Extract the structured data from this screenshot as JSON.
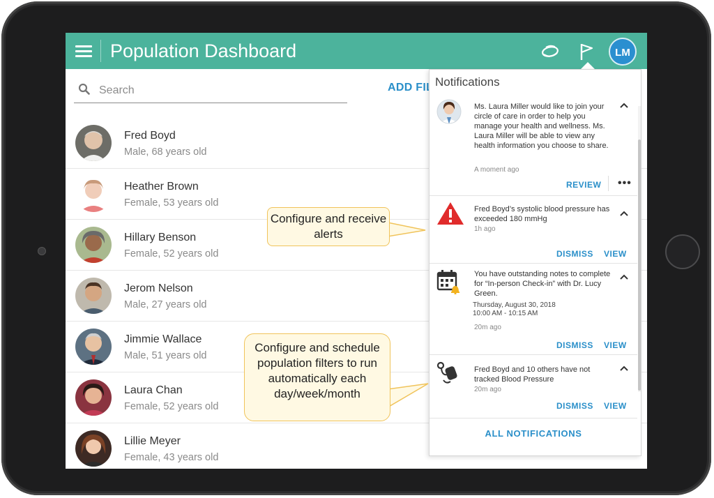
{
  "app": {
    "title": "Population Dashboard",
    "user_initials": "LM"
  },
  "search": {
    "placeholder": "Search",
    "value": ""
  },
  "add_filter_label": "ADD FIL",
  "patients": [
    {
      "name": "Fred Boyd",
      "details": "Male, 68 years old"
    },
    {
      "name": "Heather Brown",
      "details": "Female, 53 years old"
    },
    {
      "name": "Hillary Benson",
      "details": "Female, 52 years old"
    },
    {
      "name": "Jerom Nelson",
      "details": "Male, 27 years old"
    },
    {
      "name": "Jimmie Wallace",
      "details": "Male, 51 years old"
    },
    {
      "name": "Laura Chan",
      "details": "Female, 52 years old"
    },
    {
      "name": "Lillie Meyer",
      "details": "Female, 43 years old"
    }
  ],
  "callouts": {
    "alerts": "Configure and receive alerts",
    "schedule": "Configure and schedule population filters to run automatically each day/week/month"
  },
  "notifications": {
    "header": "Notifications",
    "items": [
      {
        "text": "Ms. Laura Miller would like to join your circle of care in order to help you manage your health and wellness.  Ms. Laura Miller will be able to view any health information you choose to share.",
        "time": "A moment ago",
        "primary_action": "REVIEW",
        "more": "•••"
      },
      {
        "text": "Fred Boyd’s systolic blood pressure has exceeded 180 mmHg",
        "time": "1h ago",
        "dismiss": "DISMISS",
        "view": "VIEW"
      },
      {
        "text": "You have outstanding notes to complete for “In-person Check-in” with Dr. Lucy Green.",
        "date": "Thursday, August 30, 2018",
        "time_range": "10:00 AM - 10:15 AM",
        "time": "20m ago",
        "dismiss": "DISMISS",
        "view": "VIEW"
      },
      {
        "text": "Fred Boyd and 10 others have not tracked Blood Pressure",
        "time": "20m ago",
        "dismiss": "DISMISS",
        "view": "VIEW"
      }
    ],
    "all_label": "ALL NOTIFICATIONS"
  },
  "colors": {
    "appbar": "#4cb39c",
    "accent": "#2a8fc9",
    "alert": "#e02b2b",
    "avatar": "#2a8fd0"
  },
  "icons": [
    "menu-icon",
    "circle-of-care-icon",
    "flag-icon",
    "search-icon",
    "warning-icon",
    "calendar-bell-icon",
    "blood-pressure-cuff-icon",
    "chevron-up-icon"
  ]
}
